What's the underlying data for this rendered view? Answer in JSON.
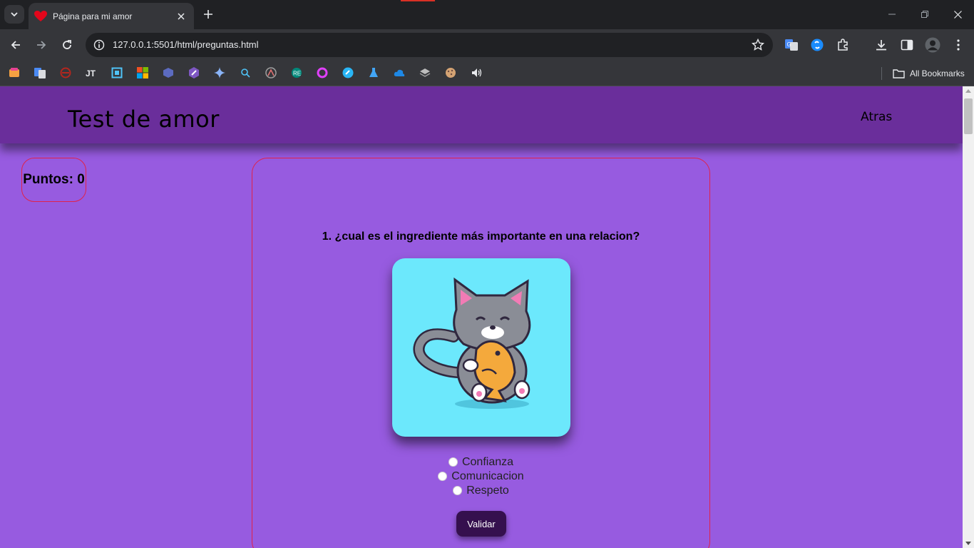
{
  "browser": {
    "tab_title": "Página para mi amor",
    "url": "127.0.0.1:5501/html/preguntas.html",
    "bookmarks_all_label": "All Bookmarks",
    "colors": {
      "frame": "#202124",
      "toolbar": "#35363a",
      "accent": "#d93025"
    }
  },
  "page": {
    "site_title": "Test de amor",
    "back_label": "Atras",
    "score_label": "Puntos: 0",
    "question": "1. ¿cual es el ingrediente más importante en una relacion?",
    "image_alt": "cat-hugging-fish-illustration",
    "options": [
      "Confianza",
      "Comunicacion",
      "Respeto"
    ],
    "validate_label": "Validar",
    "colors": {
      "background": "#975be0",
      "header": "#6a2e9b",
      "border": "#e0224a",
      "button": "#35104e",
      "image_bg": "#6ce8fc"
    }
  }
}
